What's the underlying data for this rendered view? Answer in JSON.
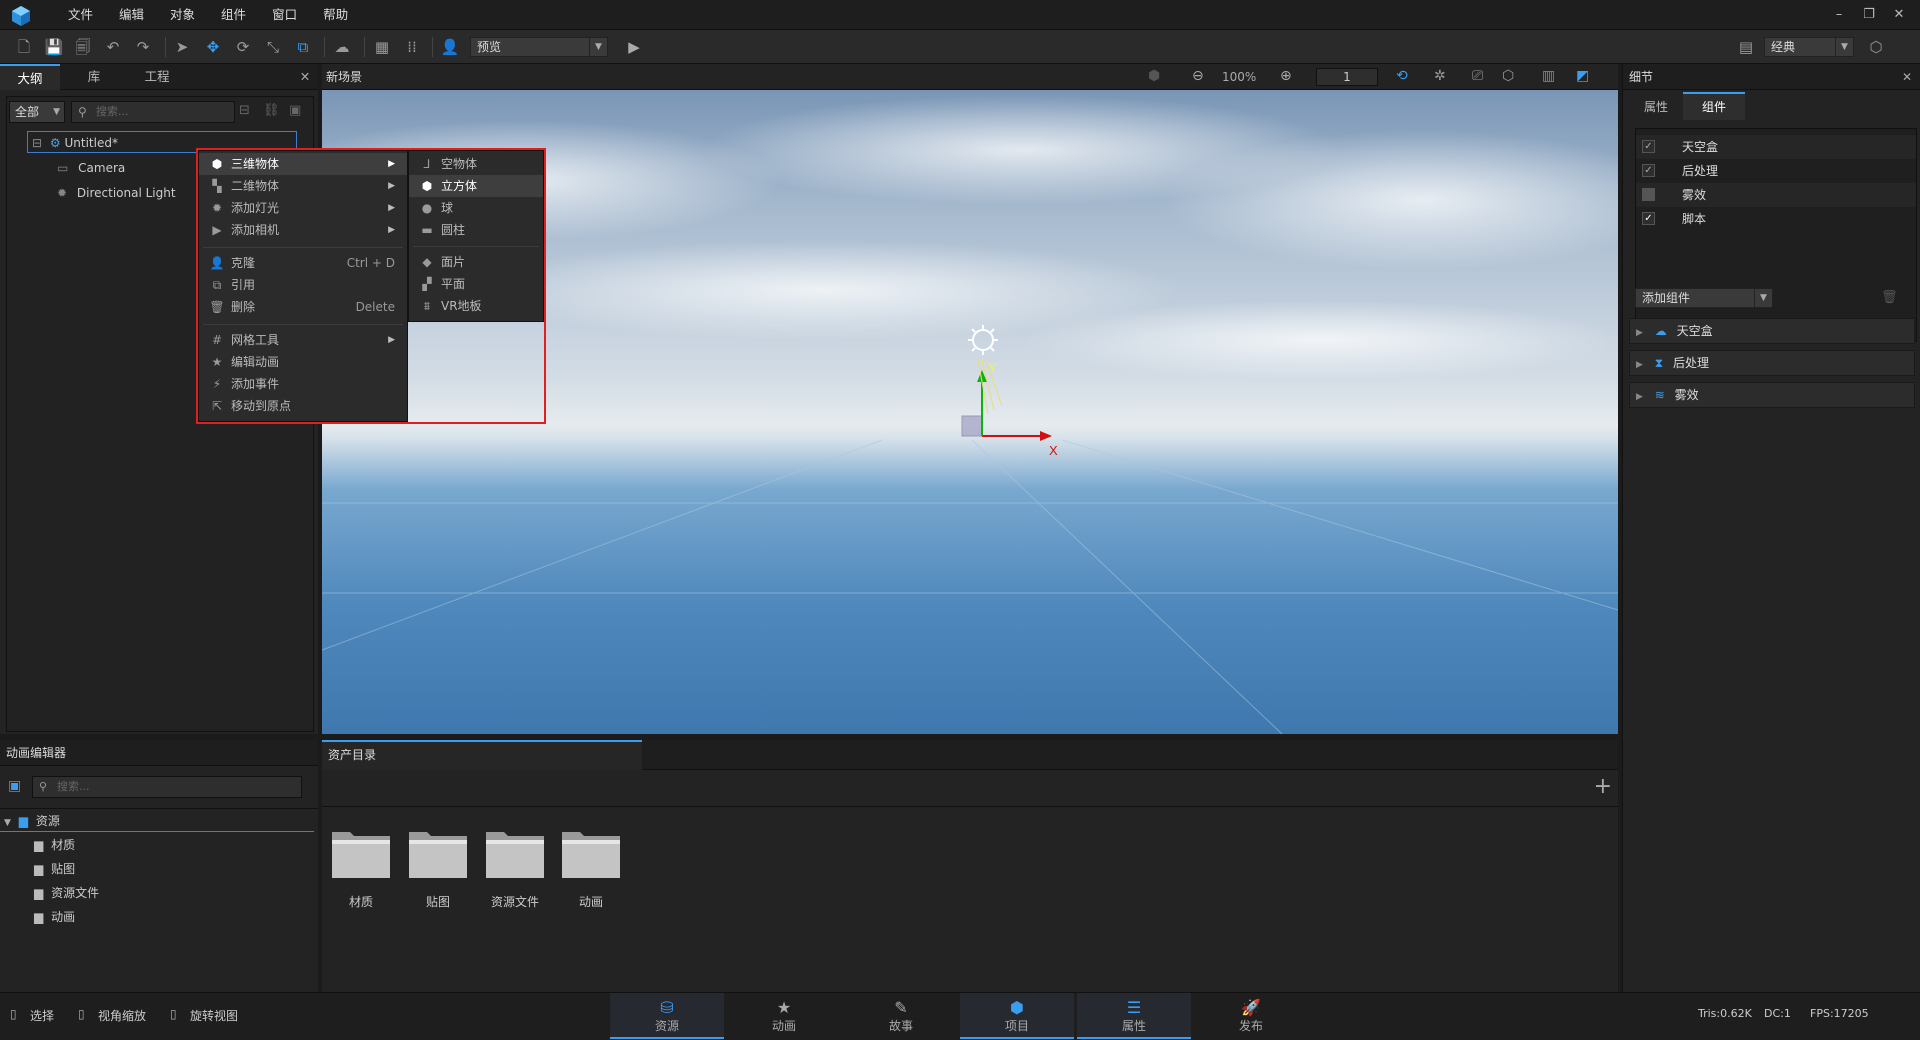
{
  "menubar": {
    "items": [
      "文件",
      "编辑",
      "对象",
      "组件",
      "窗口",
      "帮助"
    ]
  },
  "toolbar": {
    "preview_mode": "预览",
    "layout_mode": "经典"
  },
  "left_panel": {
    "tabs": [
      "大纲",
      "库",
      "工程"
    ],
    "filter_value": "全部",
    "search_placeholder": "搜索...",
    "tree": [
      {
        "label": "Untitled*"
      },
      {
        "label": "Camera"
      },
      {
        "label": "Directional Light"
      }
    ]
  },
  "context_menu": {
    "items": [
      {
        "label": "三维物体"
      },
      {
        "label": "二维物体"
      },
      {
        "label": "添加灯光"
      },
      {
        "label": "添加相机"
      },
      {
        "label": "克隆",
        "shortcut": "Ctrl + D"
      },
      {
        "label": "引用"
      },
      {
        "label": "删除",
        "shortcut": "Delete"
      },
      {
        "label": "网格工具"
      },
      {
        "label": "编辑动画"
      },
      {
        "label": "添加事件"
      },
      {
        "label": "移动到原点"
      }
    ],
    "submenu": [
      {
        "label": "空物体"
      },
      {
        "label": "立方体"
      },
      {
        "label": "球"
      },
      {
        "label": "圆柱"
      },
      {
        "label": "面片"
      },
      {
        "label": "平面"
      },
      {
        "label": "VR地板"
      }
    ]
  },
  "viewport": {
    "title": "新场景",
    "zoom": "100%",
    "number_field": "1",
    "axis_x": "X",
    "axis_y": "Y"
  },
  "right_panel": {
    "title": "细节",
    "tabs": [
      "属性",
      "组件"
    ],
    "components": [
      {
        "label": "天空盒",
        "checked": true
      },
      {
        "label": "后处理",
        "checked": true
      },
      {
        "label": "雾效",
        "checked": false
      },
      {
        "label": "脚本",
        "checked": true
      }
    ],
    "add_component": "添加组件",
    "sections": [
      "天空盒",
      "后处理",
      "雾效"
    ]
  },
  "anim_editor": {
    "title": "动画编辑器",
    "search_placeholder": "搜索...",
    "tree_root": "资源",
    "tree_items": [
      "材质",
      "贴图",
      "资源文件",
      "动画"
    ]
  },
  "asset_panel": {
    "title": "资产目录",
    "folders": [
      "材质",
      "贴图",
      "资源文件",
      "动画"
    ]
  },
  "statusbar": {
    "tools": [
      "选择",
      "视角缩放",
      "旋转视图"
    ],
    "tabs": [
      "资源",
      "动画",
      "故事",
      "项目",
      "属性",
      "发布"
    ],
    "tris": "Tris:0.62K",
    "dc": "DC:1",
    "fps": "FPS:17205"
  },
  "colors": {
    "accent": "#3a9df0",
    "highlight_box": "#e02020"
  }
}
